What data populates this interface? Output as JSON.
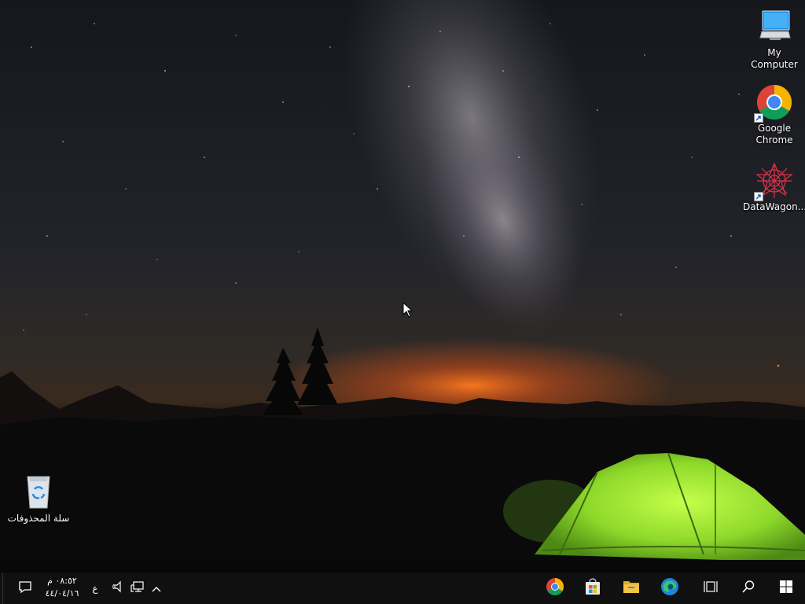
{
  "desktop": {
    "icons": [
      {
        "label": "My Computer",
        "icon": "computer-icon"
      },
      {
        "label": "Google Chrome",
        "icon": "chrome-icon"
      },
      {
        "label": "DataWagon...",
        "icon": "datawagon-icon"
      },
      {
        "label": "سلة المحذوفات",
        "icon": "recycle-bin-icon"
      }
    ]
  },
  "taskbar": {
    "clock_time": "٠٨:٥٢ م",
    "clock_date": "٤٤/٠٤/١٦",
    "language": "ع",
    "apps": [
      "chrome-icon",
      "store-icon",
      "file-explorer-icon",
      "edge-icon",
      "task-view-icon",
      "search-icon",
      "start-icon"
    ]
  },
  "colors": {
    "taskbar_bg": "#101010",
    "tent_green": "#9be22d",
    "horizon_orange": "#e8651a"
  }
}
